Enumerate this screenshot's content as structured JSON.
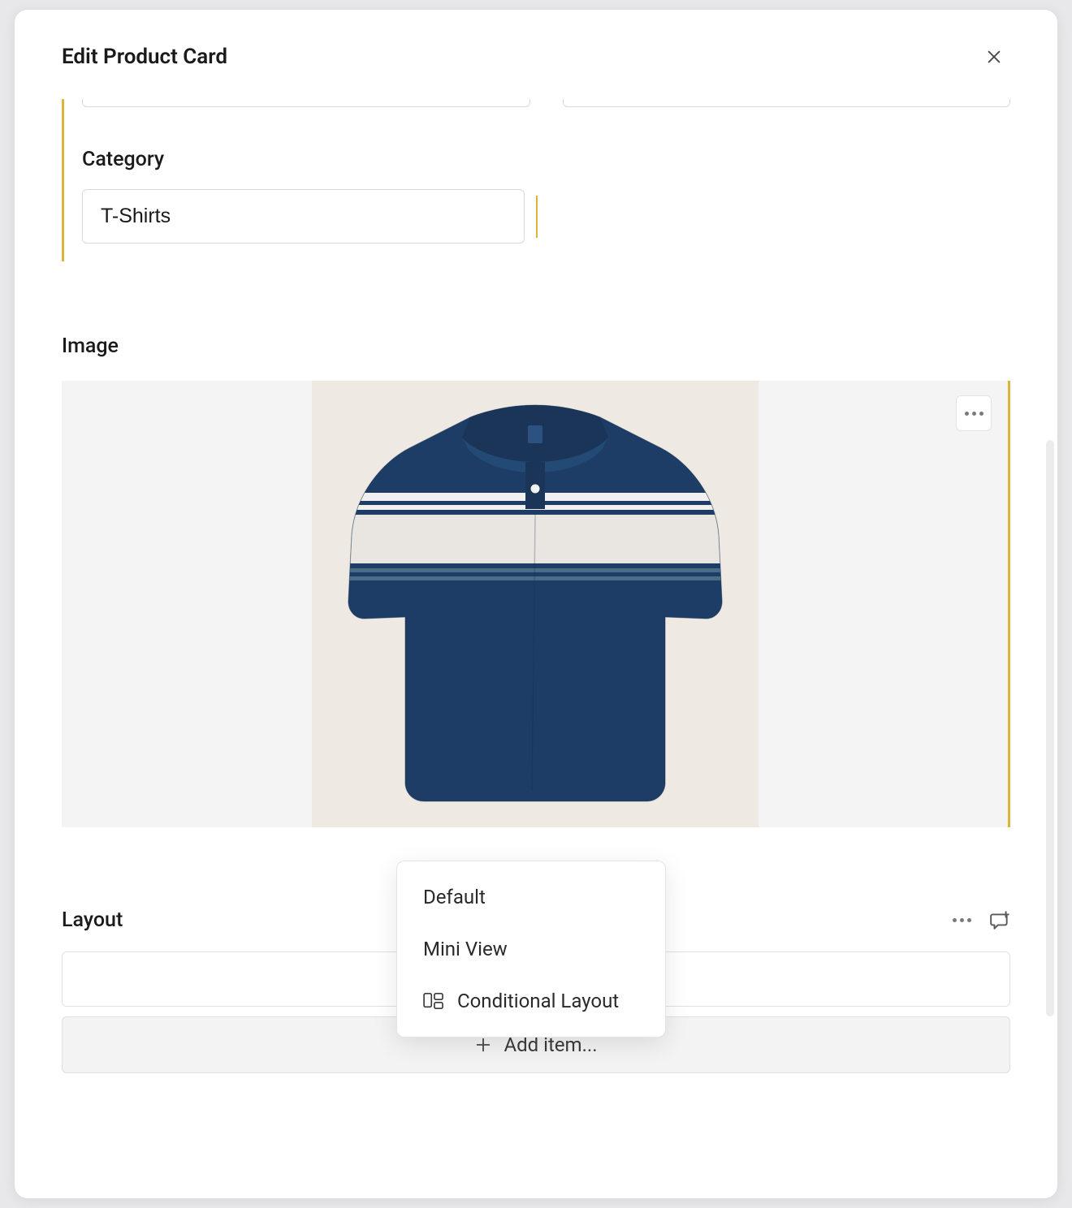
{
  "modal": {
    "title": "Edit Product Card"
  },
  "fields": {
    "category": {
      "label": "Category",
      "value": "T-Shirts"
    }
  },
  "image": {
    "label": "Image"
  },
  "layout": {
    "label": "Layout",
    "addItemLabel": "Add item...",
    "dropdown": {
      "default": "Default",
      "miniView": "Mini View",
      "conditional": "Conditional Layout"
    }
  }
}
